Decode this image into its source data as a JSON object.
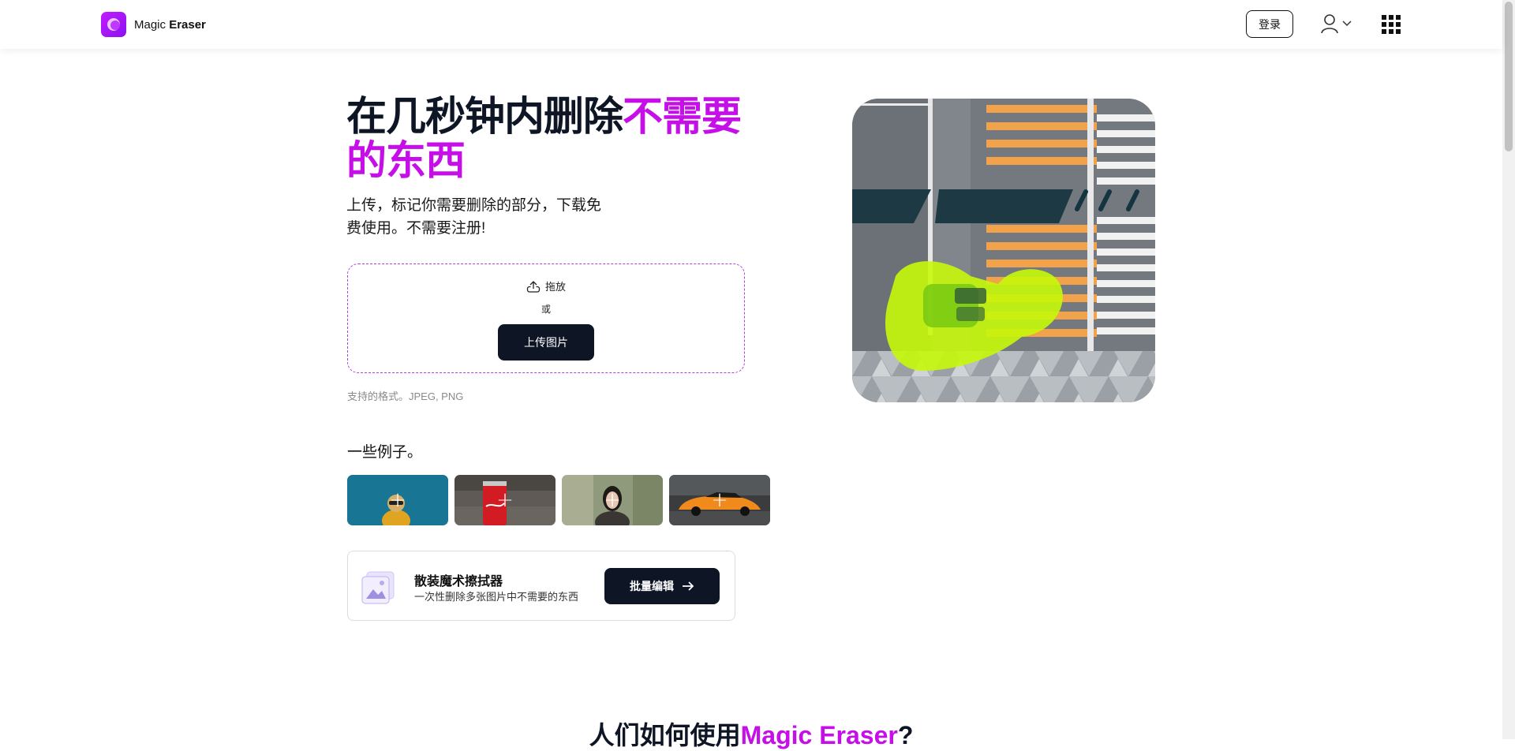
{
  "header": {
    "brand_light": "Magic ",
    "brand_bold": "Eraser",
    "login_label": "登录",
    "icons": [
      "logo-icon",
      "user-icon",
      "chevron-down-icon",
      "apps-grid-icon"
    ]
  },
  "hero": {
    "title_part1": "在几秒钟内删除",
    "title_accent": "不需要的东西",
    "subtitle": "上传，标记你需要删除的部分，下载免费使用。不需要注册!",
    "drag_label": "拖放",
    "or_label": "或",
    "upload_button": "上传图片",
    "formats": "支持的格式。JPEG, PNG",
    "image": "aerial-road-with-highlighted-car"
  },
  "examples": {
    "title": "一些例子。",
    "items": [
      {
        "name": "dog-with-sunglasses",
        "icon": "plus-icon"
      },
      {
        "name": "coca-cola-can",
        "icon": "plus-icon"
      },
      {
        "name": "woman-portrait",
        "icon": "plus-icon"
      },
      {
        "name": "orange-sports-car",
        "icon": "plus-icon"
      }
    ]
  },
  "bulk": {
    "title": "散装魔术擦拭器",
    "description": "一次性删除多张图片中不需要的东西",
    "button": "批量编辑",
    "icon": "photo-stack-icon"
  },
  "section2": {
    "title_prefix": "人们如何使用",
    "title_brand": "Magic Eraser",
    "title_suffix": "?"
  },
  "colors": {
    "accent": "#c60ee8",
    "dark": "#0e1525",
    "highlight": "#c6f80a"
  }
}
